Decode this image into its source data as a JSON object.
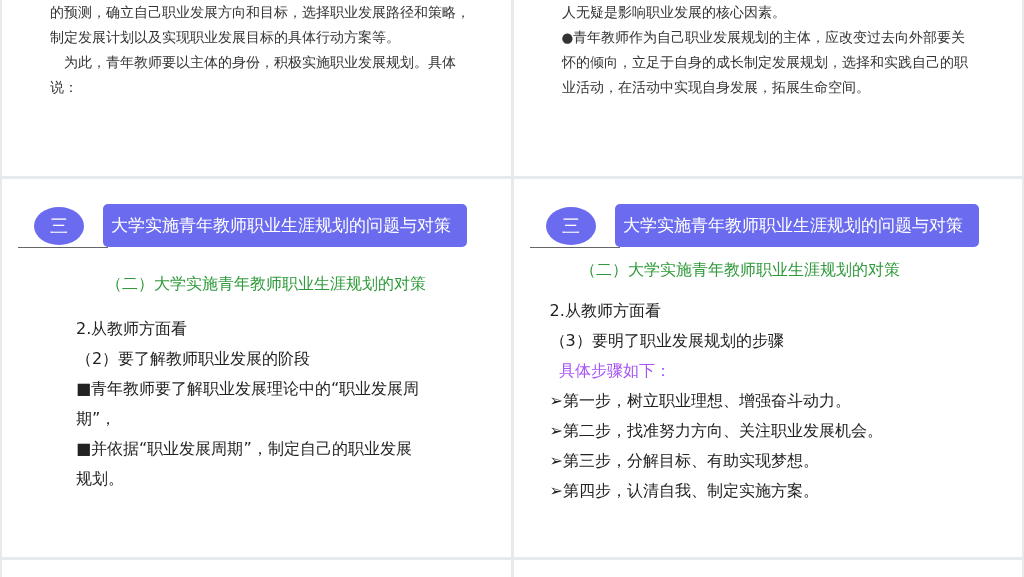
{
  "slides": [
    {
      "kind": "text",
      "lines": [
        {
          "text": "的预测，确立自己职业发展方向和目标，选择职业发展路径和策略，",
          "indent": false
        },
        {
          "text": "制定发展计划以及实现职业发展目标的具体行动方案等。",
          "indent": false
        },
        {
          "text": "为此，青年教师要以主体的身份，积极实施职业发展规划。具体",
          "indent": true
        },
        {
          "text": "说：",
          "indent": false
        }
      ]
    },
    {
      "kind": "text",
      "lines": [
        {
          "text": "人无疑是影响职业发展的核心因素。",
          "indent": false
        },
        {
          "text": "●青年教师作为自己职业发展规划的主体，应改变过去向外部要关",
          "indent": false
        },
        {
          "text": "怀的倾向，立足于自身的成长制定发展规划，选择和实践自己的职",
          "indent": false
        },
        {
          "text": "业活动，在活动中实现自身发展，拓展生命空间。",
          "indent": false
        }
      ]
    },
    {
      "kind": "section",
      "number": "三",
      "title": "大学实施青年教师职业生涯规划的问题与对策",
      "subtitle": "（二）大学实施青年教师职业生涯规划的对策",
      "lines": [
        {
          "text": "2.从教师方面看",
          "kind": "body"
        },
        {
          "text": "（2）要了解教师职业发展的阶段",
          "kind": "body"
        },
        {
          "text": "■青年教师要了解职业发展理论中的“职业发展周",
          "kind": "body"
        },
        {
          "text": "期”，",
          "kind": "body"
        },
        {
          "text": "■并依据“职业发展周期”，制定自己的职业发展",
          "kind": "body"
        },
        {
          "text": "规划。",
          "kind": "body"
        }
      ]
    },
    {
      "kind": "section",
      "number": "三",
      "title": "大学实施青年教师职业生涯规划的问题与对策",
      "subtitle": "（二）大学实施青年教师职业生涯规划的对策",
      "lines": [
        {
          "text": "2.从教师方面看",
          "kind": "body"
        },
        {
          "text": "（3）要明了职业发展规划的步骤",
          "kind": "body"
        },
        {
          "text": "具体步骤如下：",
          "kind": "note"
        },
        {
          "text": "➢第一步，树立职业理想、增强奋斗动力。",
          "kind": "body"
        },
        {
          "text": "➢第二步，找准努力方向、关注职业发展机会。",
          "kind": "body"
        },
        {
          "text": "➢第三步，分解目标、有助实现梦想。",
          "kind": "body"
        },
        {
          "text": "➢第四步，认清自我、制定实施方案。",
          "kind": "body"
        }
      ]
    },
    {
      "kind": "blank"
    },
    {
      "kind": "blank"
    }
  ]
}
